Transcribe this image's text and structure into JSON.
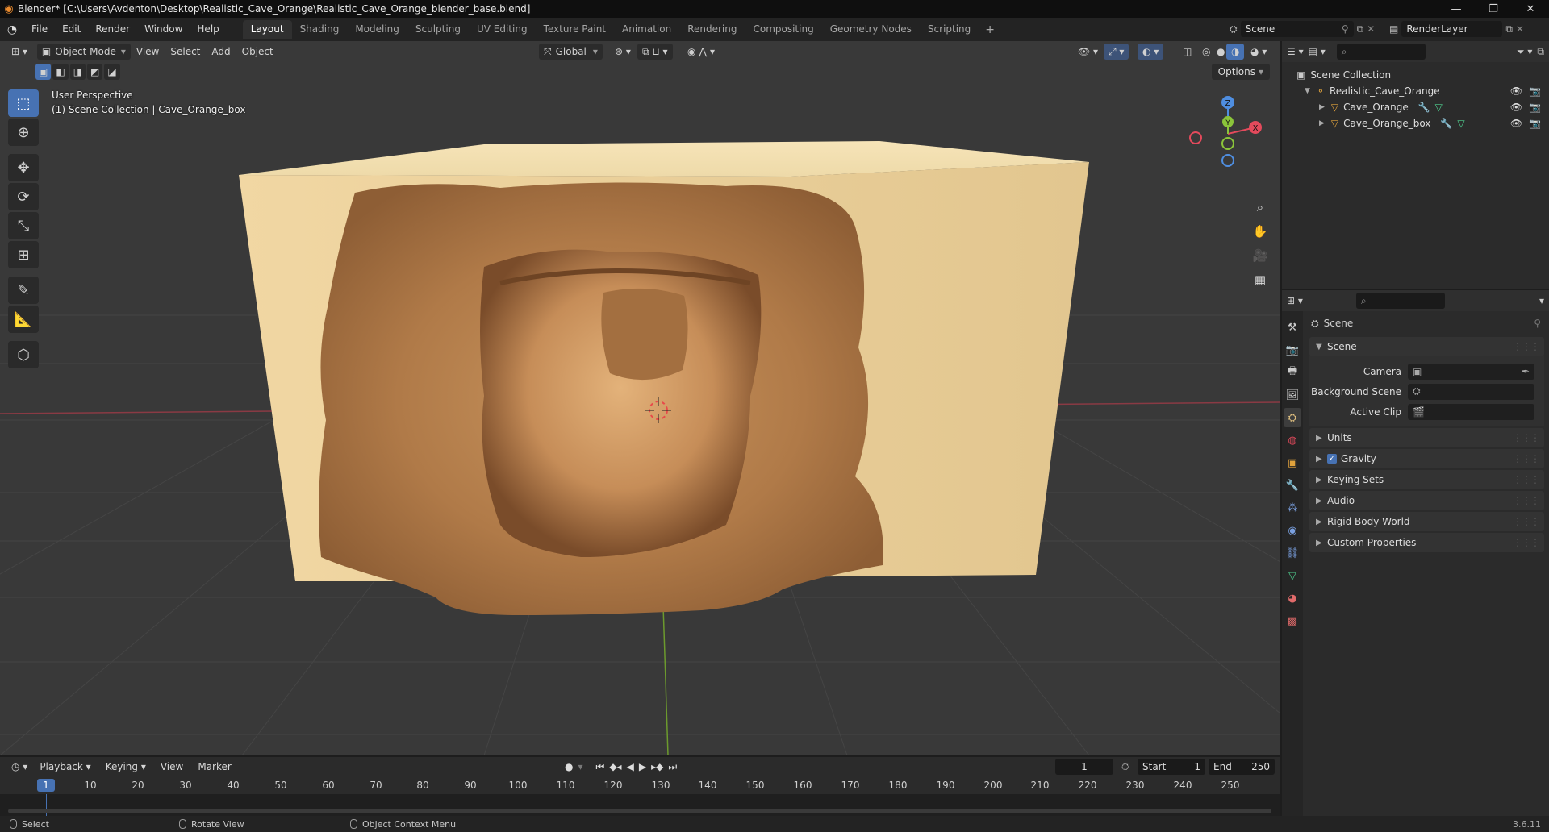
{
  "window": {
    "title": "Blender* [C:\\Users\\Avdenton\\Desktop\\Realistic_Cave_Orange\\Realistic_Cave_Orange_blender_base.blend]",
    "controls": [
      "—",
      "❐",
      "✕"
    ]
  },
  "menus": [
    "File",
    "Edit",
    "Render",
    "Window",
    "Help"
  ],
  "workspaces": [
    {
      "label": "Layout",
      "active": true
    },
    {
      "label": "Shading"
    },
    {
      "label": "Modeling"
    },
    {
      "label": "Sculpting"
    },
    {
      "label": "UV Editing"
    },
    {
      "label": "Texture Paint"
    },
    {
      "label": "Animation"
    },
    {
      "label": "Rendering"
    },
    {
      "label": "Compositing"
    },
    {
      "label": "Geometry Nodes"
    },
    {
      "label": "Scripting"
    }
  ],
  "scene_selector": {
    "scene": "Scene",
    "view_layer": "RenderLayer"
  },
  "viewport": {
    "mode": "Object Mode",
    "menus": [
      "View",
      "Select",
      "Add",
      "Object"
    ],
    "transform_orientation": "Global",
    "options_label": "Options",
    "info_line1": "User Perspective",
    "info_line2": "(1) Scene Collection | Cave_Orange_box",
    "gizmo": {
      "x": "X",
      "y": "Y",
      "z": "Z"
    }
  },
  "outliner": {
    "root": "Scene Collection",
    "collection": "Realistic_Cave_Orange",
    "objects": [
      "Cave_Orange",
      "Cave_Orange_box"
    ]
  },
  "properties": {
    "context": "Scene",
    "panel_scene": "Scene",
    "camera_label": "Camera",
    "background_scene_label": "Background Scene",
    "active_clip_label": "Active Clip",
    "panels": [
      "Units",
      "Gravity",
      "Keying Sets",
      "Audio",
      "Rigid Body World",
      "Custom Properties"
    ],
    "gravity_checked": true
  },
  "timeline": {
    "menus": [
      "Playback",
      "Keying",
      "View",
      "Marker"
    ],
    "current_frame": "1",
    "start_label": "Start",
    "start": "1",
    "end_label": "End",
    "end": "250",
    "ticks": [
      "10",
      "20",
      "30",
      "40",
      "50",
      "60",
      "70",
      "80",
      "90",
      "100",
      "110",
      "120",
      "130",
      "140",
      "150",
      "160",
      "170",
      "180",
      "190",
      "200",
      "210",
      "220",
      "230",
      "240",
      "250"
    ]
  },
  "statusbar": {
    "select": "Select",
    "rotate": "Rotate View",
    "context_menu": "Object Context Menu",
    "version": "3.6.11"
  },
  "colors": {
    "accent": "#4772b3",
    "box": "#ecd3a0",
    "rock": "#b07a48",
    "axis_x": "#e44a5c",
    "axis_y": "#8bc43a",
    "axis_z": "#4f8ee0"
  }
}
